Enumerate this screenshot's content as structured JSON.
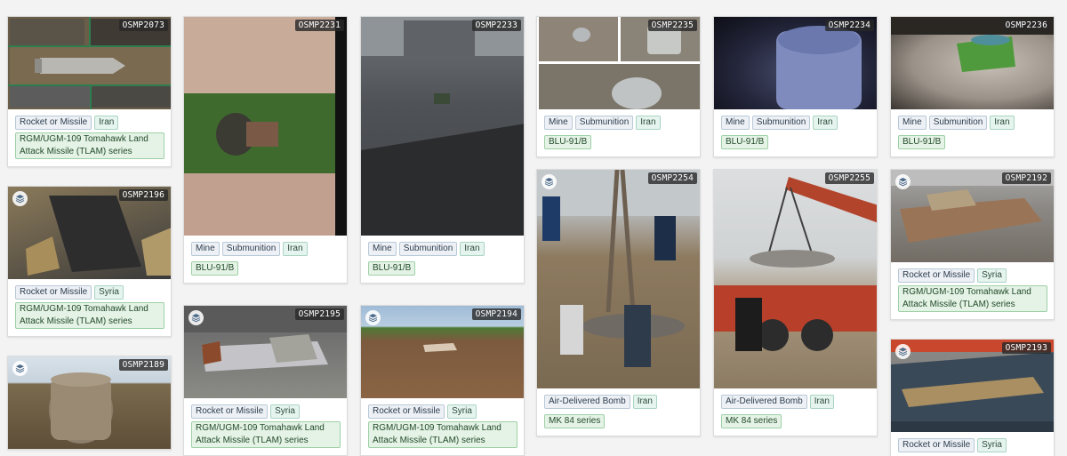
{
  "cards": [
    {
      "id": "OSMP2073",
      "tags": [
        "Rocket or Missile",
        "Iran"
      ],
      "type": "RGM/UGM-109 Tomahawk Land Attack Missile (TLAM) series"
    },
    {
      "id": "OSMP2196",
      "tags": [
        "Rocket or Missile",
        "Syria"
      ],
      "type": "RGM/UGM-109 Tomahawk Land Attack Missile (TLAM) series"
    },
    {
      "id": "OSMP2189",
      "tags": [],
      "type": ""
    },
    {
      "id": "OSMP2231",
      "tags": [
        "Mine",
        "Submunition",
        "Iran"
      ],
      "type": "BLU-91/B"
    },
    {
      "id": "OSMP2195",
      "tags": [
        "Rocket or Missile",
        "Syria"
      ],
      "type": "RGM/UGM-109 Tomahawk Land Attack Missile (TLAM) series"
    },
    {
      "id": "OSMP2233",
      "tags": [
        "Mine",
        "Submunition",
        "Iran"
      ],
      "type": "BLU-91/B"
    },
    {
      "id": "OSMP2194",
      "tags": [
        "Rocket or Missile",
        "Syria"
      ],
      "type": "RGM/UGM-109 Tomahawk Land Attack Missile (TLAM) series"
    },
    {
      "id": "OSMP2235",
      "tags": [
        "Mine",
        "Submunition",
        "Iran"
      ],
      "type": "BLU-91/B"
    },
    {
      "id": "OSMP2254",
      "tags": [
        "Air-Delivered Bomb",
        "Iran"
      ],
      "type": "MK 84 series"
    },
    {
      "id": "OSMP2234",
      "tags": [
        "Mine",
        "Submunition",
        "Iran"
      ],
      "type": "BLU-91/B"
    },
    {
      "id": "OSMP2255",
      "tags": [
        "Air-Delivered Bomb",
        "Iran"
      ],
      "type": "MK 84 series"
    },
    {
      "id": "OSMP2236",
      "tags": [
        "Mine",
        "Submunition",
        "Iran"
      ],
      "type": "BLU-91/B"
    },
    {
      "id": "OSMP2192",
      "tags": [
        "Rocket or Missile",
        "Syria"
      ],
      "type": "RGM/UGM-109 Tomahawk Land Attack Missile (TLAM) series"
    },
    {
      "id": "OSMP2193",
      "tags": [
        "Rocket or Missile",
        "Syria"
      ],
      "type": ""
    }
  ]
}
